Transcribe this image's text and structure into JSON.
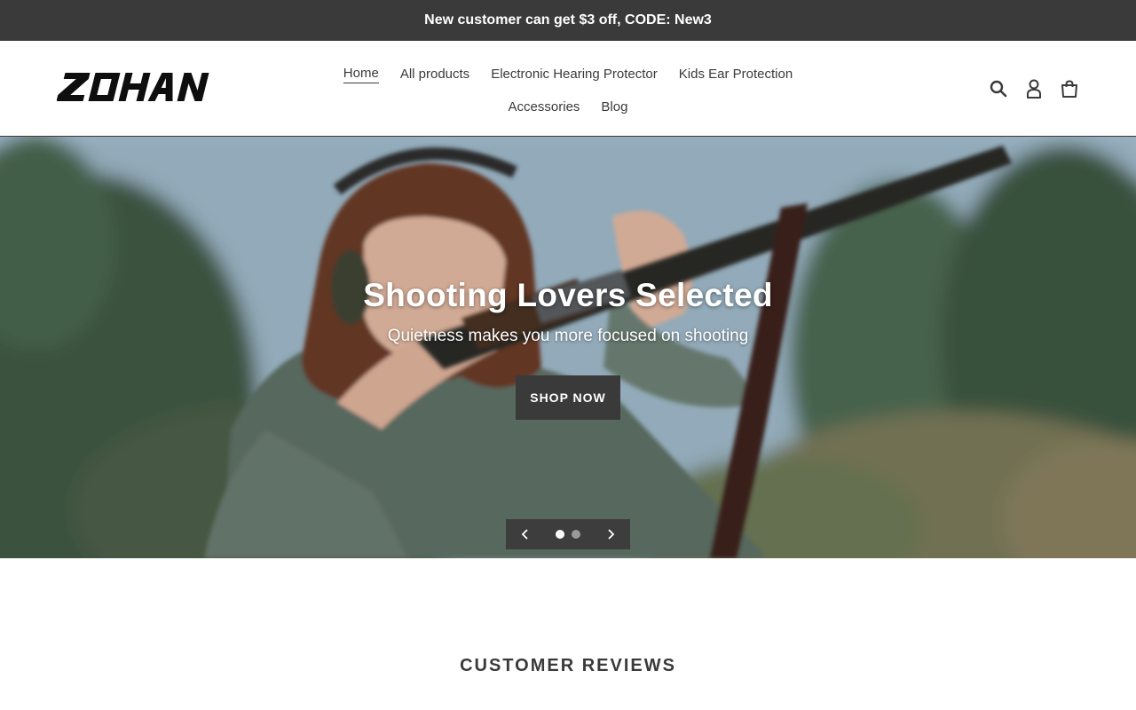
{
  "announcement": "New customer can get $3 off, CODE: New3",
  "brand": {
    "logo_text": "ZOHAN"
  },
  "nav": {
    "row1": [
      {
        "label": "Home",
        "active": true
      },
      {
        "label": "All products"
      },
      {
        "label": "Electronic Hearing Protector"
      },
      {
        "label": "Kids Ear Protection"
      }
    ],
    "row2": [
      {
        "label": "Accessories"
      },
      {
        "label": "Blog"
      }
    ]
  },
  "header_icons": [
    "search-icon",
    "account-icon",
    "cart-icon"
  ],
  "hero": {
    "title": "Shooting Lovers Selected",
    "subtitle": "Quietness makes you more focused on shooting",
    "cta": "Shop now",
    "slide_count": 2,
    "active_slide": 1
  },
  "reviews": {
    "heading": "CUSTOMER REVIEWS"
  },
  "colors": {
    "dark": "#3a3a3a",
    "white": "#ffffff"
  }
}
